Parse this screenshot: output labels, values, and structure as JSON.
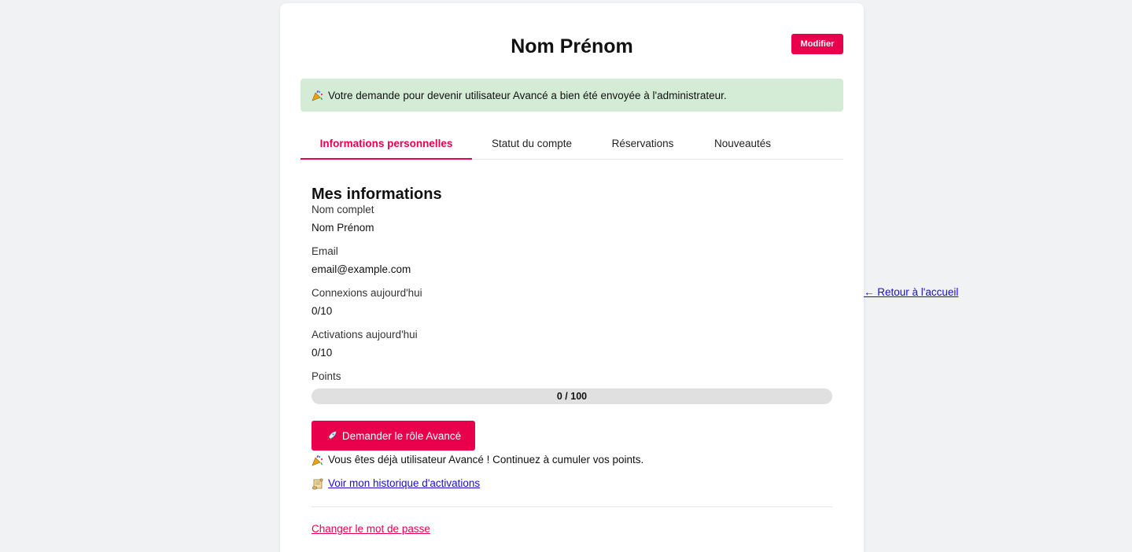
{
  "header": {
    "title": "Nom Prénom",
    "edit_label": "Modifier"
  },
  "alert": {
    "icon": "party-popper-icon",
    "message": "Votre demande pour devenir utilisateur Avancé a bien été envoyée à l'administrateur."
  },
  "tabs": [
    {
      "label": "Informations personnelles",
      "active": true
    },
    {
      "label": "Statut du compte",
      "active": false
    },
    {
      "label": "Réservations",
      "active": false
    },
    {
      "label": "Nouveautés",
      "active": false
    }
  ],
  "info": {
    "section_title": "Mes informations",
    "fields": [
      {
        "label": "Nom complet",
        "value": "Nom Prénom"
      },
      {
        "label": "Email",
        "value": "email@example.com"
      },
      {
        "label": "Connexions aujourd'hui",
        "value": "0/10"
      },
      {
        "label": "Activations aujourd'hui",
        "value": "0/10"
      }
    ],
    "points": {
      "label": "Points",
      "current": 0,
      "max": 100,
      "text": "0 / 100"
    }
  },
  "actions": {
    "role_button_label": "Demander le rôle Avancé",
    "role_button_icon": "rocket-icon",
    "note_icon": "party-popper-icon",
    "note": "Vous êtes déjà utilisateur Avancé ! Continuez à cumuler vos points.",
    "history_icon": "scroll-icon",
    "history_link": "Voir mon historique d'activations",
    "password_link": "Changer le mot de passe"
  },
  "back_link": "← Retour à l'accueil",
  "colors": {
    "accent": "#e8004d",
    "alert_bg": "#d4ecd6",
    "link": "#1a0dcc",
    "page_bg": "#f1f2f4"
  }
}
